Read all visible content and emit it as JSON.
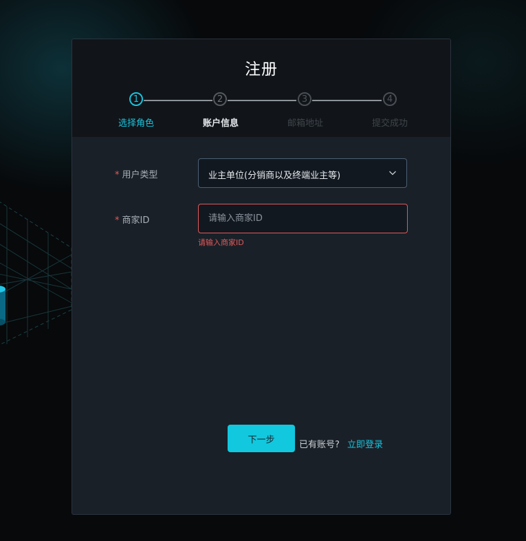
{
  "page": {
    "title": "注册"
  },
  "steps": [
    {
      "number": "1",
      "label": "选择角色",
      "state": "active"
    },
    {
      "number": "2",
      "label": "账户信息",
      "state": "current"
    },
    {
      "number": "3",
      "label": "邮箱地址",
      "state": "pending"
    },
    {
      "number": "4",
      "label": "提交成功",
      "state": "pending"
    }
  ],
  "form": {
    "required_mark": "*",
    "user_type": {
      "label": "用户类型",
      "value": "业主单位(分销商以及终端业主等)"
    },
    "merchant_id": {
      "label": "商家ID",
      "value": "",
      "placeholder": "请输入商家ID",
      "error": "请输入商家ID"
    }
  },
  "actions": {
    "next_label": "下一步",
    "have_account_text": "已有账号?",
    "login_link_label": "立即登录"
  },
  "colors": {
    "accent": "#11c8de",
    "error": "#e05a5a",
    "card_bg": "#1a2028",
    "header_bg": "#11151a"
  }
}
